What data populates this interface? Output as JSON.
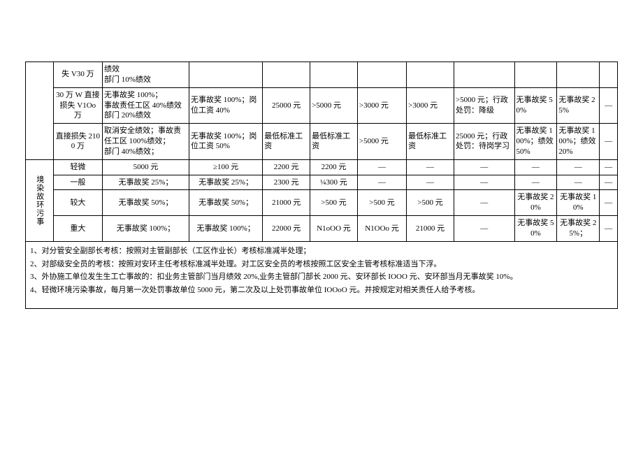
{
  "rows": [
    {
      "a": "失 V30 万",
      "b": "绩效\n部门 10%绩效",
      "c": "",
      "d": "",
      "e": "",
      "f": "",
      "g": "",
      "h": "",
      "i": "",
      "j": "",
      "k": ""
    },
    {
      "a": "30 万 W 直接损失 V1Oo 万",
      "b": "无事故奖 100%；\n事故责任工区 40%绩效\n部门 20%绩效",
      "c": "无事故奖 100%；岗位工资 40%",
      "d": "25000 元",
      "e": ">5000 元",
      "f": ">3000 元",
      "g": ">3000 元",
      "h": ">5000 元；行政处罚：降级",
      "i": "无事故奖 50%",
      "j": "无事故奖 25%",
      "k": "—"
    },
    {
      "a": "直接损失 2100 万",
      "b": "取消安全绩效；事故责任工区 100%绩效；\n部门 40%绩效；",
      "c": "无事故奖 100%；岗位工资 50%",
      "d": "最低标准工资",
      "e": "最低标准工资",
      "f": ">5000 元",
      "g": "最低标准工资",
      "h": "25000 元；行政处罚：待岗学习",
      "i": "无事故奖 100%；绩效 50%",
      "j": "无事故奖 100%；绩效 20%",
      "k": "—"
    }
  ],
  "envLabel": "境染故环污事",
  "env": [
    {
      "a": "轻微",
      "b": "5000 元",
      "c": "≥100 元",
      "d": "2200 元",
      "e": "2200 元",
      "f": "—",
      "g": "—",
      "h": "—",
      "i": "—",
      "j": "—",
      "k": "—"
    },
    {
      "a": "一般",
      "b": "无事故奖 25%；",
      "c": "无事故奖 25%；",
      "d": "2300 元",
      "e": "¼300 元",
      "f": "—",
      "g": "—",
      "h": "—",
      "i": "—",
      "j": "—",
      "k": "—"
    },
    {
      "a": "较大",
      "b": "无事故奖 50%；",
      "c": "无事故奖 50%；",
      "d": "21000 元",
      "e": ">500 元",
      "f": ">500 元",
      "g": ">500 元",
      "h": "—",
      "i": "无事故奖 20%",
      "j": "无事故奖 10%",
      "k": "—"
    },
    {
      "a": "重大",
      "b": "无事故奖 100%；",
      "c": "无事故奖 100%；",
      "d": "22000 元",
      "e": "N1oOO 元",
      "f": "N1OOo 元",
      "g": "21000 元",
      "h": "—",
      "i": "无事故奖 50%",
      "j": "无事故奖 25%；",
      "k": "—"
    }
  ],
  "notes": [
    "1、对分管安全副部长考核：按照对主管副部长（工区作业长）考核标准减半处理；",
    "2、对部级安全员的考核：按照对安环主任考核标准减半处理。对工区安全员的考核按照工区安全主管考核标准适当下浮。",
    "3、外协施工单位发生生工亡事故的：扣业务主管部门当月绩效 20%,业务主管部门部长 2000 元、安环部长 IOOO 元、安环部当月无事故奖 10%。",
    "4、轻微环境污染事故，每月第一次处罚事故单位 5000 元，第二次及以上处罚事故单位 IOOoO 元。并按规定对相关责任人给予考核。"
  ]
}
